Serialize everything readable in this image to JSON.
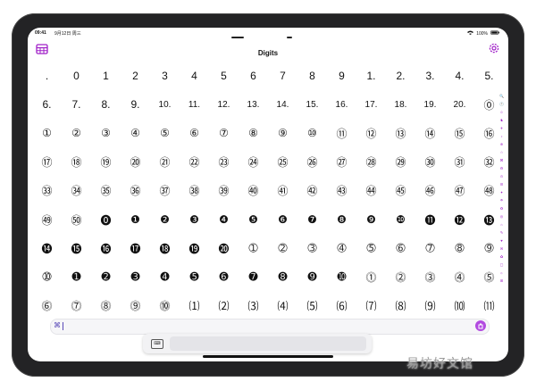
{
  "status": {
    "time": "09:41",
    "date": "9月12日 周三",
    "battery": "100%"
  },
  "header": {
    "title": "Digits"
  },
  "digits": [
    [
      ".",
      "0",
      "1",
      "2",
      "3",
      "4",
      "5",
      "6",
      "7",
      "8",
      "9",
      "1.",
      "2.",
      "3.",
      "4.",
      "5."
    ],
    [
      "6.",
      "7.",
      "8.",
      "9.",
      "10.",
      "11.",
      "12.",
      "13.",
      "14.",
      "15.",
      "16.",
      "17.",
      "18.",
      "19.",
      "20.",
      "⓪"
    ],
    [
      "①",
      "②",
      "③",
      "④",
      "⑤",
      "⑥",
      "⑦",
      "⑧",
      "⑨",
      "⑩",
      "⑪",
      "⑫",
      "⑬",
      "⑭",
      "⑮",
      "⑯"
    ],
    [
      "⑰",
      "⑱",
      "⑲",
      "⑳",
      "㉑",
      "㉒",
      "㉓",
      "㉔",
      "㉕",
      "㉖",
      "㉗",
      "㉘",
      "㉙",
      "㉚",
      "㉛",
      "㉜"
    ],
    [
      "㉝",
      "㉞",
      "㉟",
      "㊱",
      "㊲",
      "㊳",
      "㊴",
      "㊵",
      "㊶",
      "㊷",
      "㊸",
      "㊹",
      "㊺",
      "㊻",
      "㊼",
      "㊽"
    ],
    [
      "㊾",
      "㊿",
      "⓿",
      "❶",
      "❷",
      "❸",
      "❹",
      "❺",
      "❻",
      "❼",
      "❽",
      "❾",
      "❿",
      "⓫",
      "⓬",
      "⓭"
    ],
    [
      "⓮",
      "⓯",
      "⓰",
      "⓱",
      "⓲",
      "⓳",
      "⓴",
      "➀",
      "➁",
      "➂",
      "➃",
      "➄",
      "➅",
      "➆",
      "➇",
      "➈"
    ],
    [
      "➉",
      "➊",
      "➋",
      "➌",
      "➍",
      "➎",
      "➏",
      "➐",
      "➑",
      "➒",
      "➓",
      "⓵",
      "⓶",
      "⓷",
      "⓸",
      "⓹"
    ],
    [
      "⓺",
      "⓻",
      "⓼",
      "⓽",
      "⓾",
      "⑴",
      "⑵",
      "⑶",
      "⑷",
      "⑸",
      "⑹",
      "⑺",
      "⑻",
      "⑼",
      "⑽",
      "⑾"
    ]
  ],
  "side_index": [
    "🔍",
    "🕐",
    "☺",
    "♞",
    "✈",
    "♪",
    "⊕",
    "☆",
    "⌘",
    "⚙",
    "⊙",
    "☰",
    "✦",
    "☂",
    "♻",
    "◎",
    "⌂",
    "✎",
    "♥",
    "✉",
    "✿",
    "▢",
    "☼",
    "⊞"
  ],
  "searchbar": {
    "icon": "⌘"
  },
  "keyboard": {
    "icon": "⌨"
  },
  "icons": {
    "table": "table-icon",
    "settings": "gear-icon",
    "submit": "submit-icon"
  },
  "watermark": "易坊好文馆"
}
